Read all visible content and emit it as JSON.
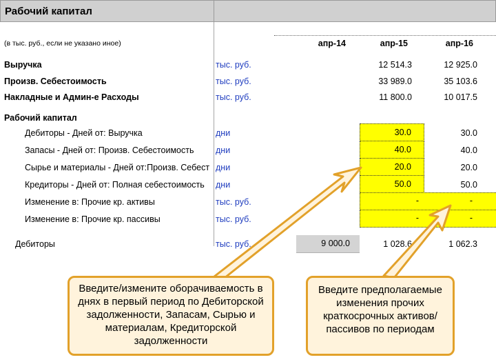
{
  "title": "Рабочий капитал",
  "units_note": "(в тыс. руб., если не указано иное)",
  "columns": [
    "апр-14",
    "апр-15",
    "апр-16"
  ],
  "rows": {
    "revenue": {
      "label": "Выручка",
      "unit": "тыс. руб.",
      "v2": "12 514.3",
      "v3": "12 925.0"
    },
    "cogs": {
      "label": "Произв. Себестоимость",
      "unit": "тыс. руб.",
      "v2": "33 989.0",
      "v3": "35 103.6"
    },
    "overhead": {
      "label": "Накладные и Админ-е Расходы",
      "unit": "тыс. руб.",
      "v2": "11 800.0",
      "v3": "10 017.5"
    },
    "wc_section": "Рабочий капитал",
    "debtors_days": {
      "label": "Дебиторы - Дней от: Выручка",
      "unit": "дни",
      "v2": "30.0",
      "v3": "30.0"
    },
    "inventory_days": {
      "label": "Запасы - Дней от: Произв. Себестоимость",
      "unit": "дни",
      "v2": "40.0",
      "v3": "40.0"
    },
    "raw_days": {
      "label": "Сырье и материалы - Дней от:Произв. Себест",
      "unit": "дни",
      "v2": "20.0",
      "v3": "20.0"
    },
    "creditors_days": {
      "label": "Кредиторы - Дней от: Полная себестоимость",
      "unit": "дни",
      "v2": "50.0",
      "v3": "50.0"
    },
    "other_assets": {
      "label": "Изменение в: Прочие кр. активы",
      "unit": "тыс. руб.",
      "v2": "-",
      "v3": "-"
    },
    "other_liab": {
      "label": "Изменение в: Прочие кр. пассивы",
      "unit": "тыс. руб.",
      "v2": "-",
      "v3": "-"
    },
    "debtors": {
      "label": "Дебиторы",
      "unit": "тыс. руб.",
      "v1": "9 000.0",
      "v2": "1 028.6",
      "v3": "1 062.3"
    }
  },
  "callouts": {
    "left": "Введите/измените  оборачиваемость в днях в первый период по Дебиторской задолженности, Запасам, Сырью и материалам, Кредиторской задолженности",
    "right": "Введите предполагаемые изменения прочих краткосрочных активов/пассивов по периодам"
  },
  "colors": {
    "input_yellow": "#ffff00",
    "unit_blue": "#1f3dbf",
    "callout_border": "#e2a12a",
    "callout_fill": "#fff3dc"
  }
}
